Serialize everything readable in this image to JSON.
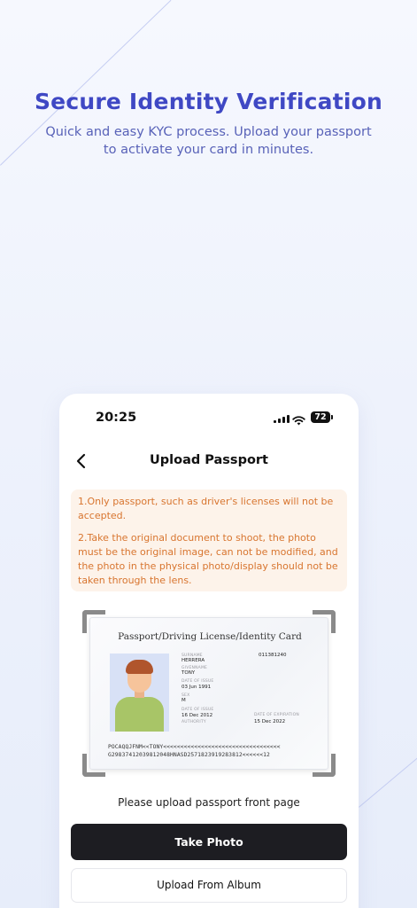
{
  "hero": {
    "title": "Secure Identity Verification",
    "subtitle": "Quick and easy KYC process. Upload your passport to activate your card in minutes."
  },
  "status_bar": {
    "time": "20:25",
    "battery": "72",
    "icons": [
      "cellular-signal-icon",
      "wifi-icon",
      "battery-icon"
    ]
  },
  "nav": {
    "back_icon": "chevron-left-icon",
    "title": "Upload Passport"
  },
  "notice": {
    "line1": "1.Only passport, such as driver's licenses will not be accepted.",
    "line2": "2.Take the original document to shoot, the photo must be the original image, can not be modified, and the photo in the physical photo/display should not be taken through the lens."
  },
  "sample_card": {
    "title": "Passport/Driving License/Identity Card",
    "number": "011381240",
    "surname_label": "SURNAME",
    "surname": "HERRERA",
    "given_label": "GIVENNAME",
    "given": "TONY",
    "dob_label": "DATE OF ISSUE",
    "dob": "03 Jun 1991",
    "sex_label": "SEX",
    "sex": "M",
    "issue_label": "DATE OF ISSUE",
    "issue": "16 Dec 2012",
    "authority_label": "AUTHORITY",
    "expiry_label": "DATE OF EXPIRATION",
    "expiry": "15 Dec 2022",
    "mrz1": "POCAQQJFNM<<TONY<<<<<<<<<<<<<<<<<<<<<<<<<<<<<<<<<<",
    "mrz2": "G29837412039812048HNASD2571823919283812<<<<<<12"
  },
  "upload_hint": "Please upload passport front page",
  "buttons": {
    "take_photo": "Take Photo",
    "upload_album": "Upload From Album"
  },
  "colors": {
    "accent": "#3f48c4",
    "notice_bg": "#fdf3ea",
    "notice_text": "#d8752f",
    "primary_button": "#1d1d22"
  }
}
